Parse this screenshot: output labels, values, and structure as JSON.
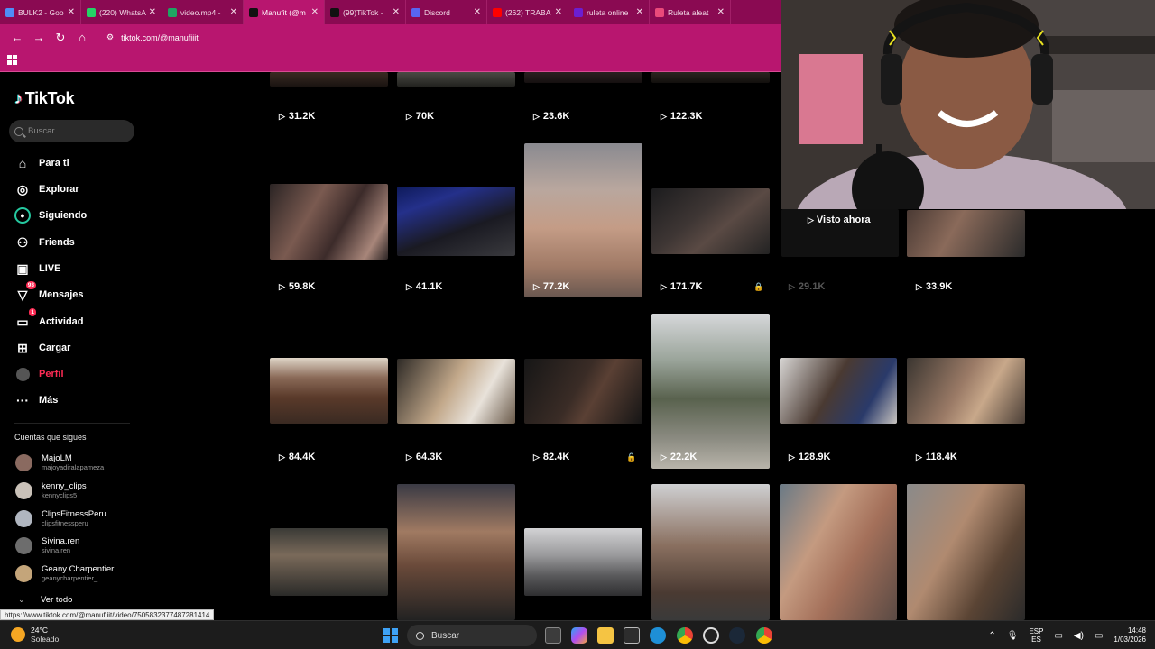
{
  "browser": {
    "tabs": [
      {
        "label": "BULK2 - Goo",
        "color": "#4f8df7"
      },
      {
        "label": "(220) WhatsA",
        "color": "#25d366"
      },
      {
        "label": "video.mp4 -",
        "color": "#1fa463"
      },
      {
        "label": "Manufit (@m",
        "color": "#111111"
      },
      {
        "label": "(99)TikTok -",
        "color": "#111111"
      },
      {
        "label": "Discord",
        "color": "#5865f2"
      },
      {
        "label": "(262) TRABA",
        "color": "#ff0000"
      },
      {
        "label": "ruleta online",
        "color": "#6b1fd1"
      },
      {
        "label": "Ruleta aleat",
        "color": "#e94a7a"
      }
    ],
    "url": "tiktok.com/@manufiiit",
    "status_url": "https://www.tiktok.com/@manufiiit/video/7505832377487281414"
  },
  "tiktok": {
    "logo": "TikTok",
    "search_placeholder": "Buscar",
    "nav": [
      {
        "label": "Para ti",
        "icon": "home-icon"
      },
      {
        "label": "Explorar",
        "icon": "compass-icon"
      },
      {
        "label": "Siguiendo",
        "icon": "following-icon"
      },
      {
        "label": "Friends",
        "icon": "friends-icon"
      },
      {
        "label": "LIVE",
        "icon": "live-icon"
      },
      {
        "label": "Mensajes",
        "icon": "messages-icon",
        "badge": "93"
      },
      {
        "label": "Actividad",
        "icon": "activity-icon",
        "badge": "1"
      },
      {
        "label": "Cargar",
        "icon": "upload-icon"
      },
      {
        "label": "Perfil",
        "icon": "profile-icon"
      },
      {
        "label": "Más",
        "icon": "more-icon"
      }
    ],
    "following_title": "Cuentas que sigues",
    "following": [
      {
        "name": "MajoLM",
        "handle": "majoyadiralapameza"
      },
      {
        "name": "kenny_clips",
        "handle": "kennyclips5"
      },
      {
        "name": "ClipsFitnessPeru",
        "handle": "clipsfitnessperu"
      },
      {
        "name": "Sivina.ren",
        "handle": "sivina.ren"
      },
      {
        "name": "Geany Charpentier",
        "handle": "geanycharpentier_"
      }
    ],
    "see_all": "Ver todo"
  },
  "grid": {
    "row0": [
      "31.2K",
      "70K",
      "23.6K",
      "122.3K"
    ],
    "row1": [
      "59.8K",
      "41.1K",
      "77.2K",
      "171.7K",
      "29.1K",
      "33.9K"
    ],
    "watched_label": "Visto ahora",
    "row2": [
      "84.4K",
      "64.3K",
      "82.4K",
      "22.2K",
      "128.9K",
      "118.4K"
    ]
  },
  "taskbar": {
    "weather_temp": "24°C",
    "weather_desc": "Soleado",
    "search": "Buscar",
    "lang_top": "ESP",
    "lang_bottom": "ES",
    "time": "14:48",
    "date": "1/03/2026"
  }
}
